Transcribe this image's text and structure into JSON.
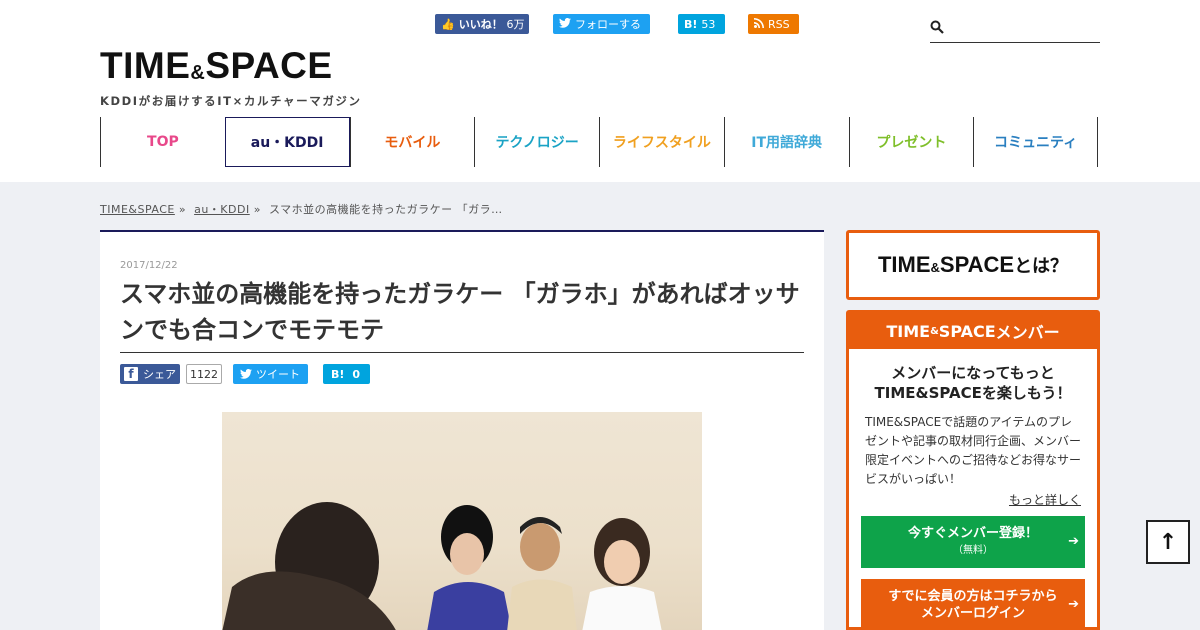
{
  "header": {
    "logo": {
      "main_left": "TIME",
      "amp": "&",
      "main_right": "SPACE",
      "tagline": "KDDIがお届けするIT×カルチャーマガジン"
    },
    "social": {
      "facebook": {
        "label": "いいね！",
        "count": "6万"
      },
      "twitter": {
        "label": "フォローする"
      },
      "hatena": {
        "label": "B!",
        "count": "53"
      },
      "rss": {
        "label": "RSS"
      }
    },
    "search": {
      "value": "",
      "placeholder": ""
    }
  },
  "nav": {
    "items": [
      {
        "label": "TOP",
        "color": "#e8488a"
      },
      {
        "label": "au・KDDI",
        "color": "#1a1a5a"
      },
      {
        "label": "モバイル",
        "color": "#e85d0e"
      },
      {
        "label": "テクノロジー",
        "color": "#1aa3c5"
      },
      {
        "label": "ライフスタイル",
        "color": "#f0a020"
      },
      {
        "label": "IT用語辞典",
        "color": "#3fa9d8"
      },
      {
        "label": "プレゼント",
        "color": "#7fbf2a"
      },
      {
        "label": "コミュニティ",
        "color": "#2a7fc0"
      }
    ],
    "active_index": 1
  },
  "breadcrumb": {
    "items": [
      "TIME&SPACE",
      "au・KDDI",
      "スマホ並の高機能を持ったガラケー 「ガラ…"
    ],
    "separator": "»"
  },
  "article": {
    "date": "2017/12/22",
    "title": "スマホ並の高機能を持ったガラケー 「ガラホ」があればオッサンでも合コンでモテモテ",
    "share": {
      "facebook_label": "シェア",
      "facebook_count": "1122",
      "twitter_label": "ツイート",
      "hatena_label": "B!",
      "hatena_count": "0"
    }
  },
  "sidebar": {
    "about": {
      "main_left": "TIME",
      "amp": "&",
      "main_right": "SPACE",
      "suffix": "とは？"
    },
    "member": {
      "header_left": "TIME",
      "header_amp": "&",
      "header_right": "SPACE",
      "header_suffix": " メンバー",
      "lead_line1": "メンバーになってもっと",
      "lead_line2": "TIME&SPACEを楽しもう！",
      "body": "TIME&SPACEで話題のアイテムのプレゼントや記事の取材同行企画、メンバー限定イベントへのご招待などお得なサービスがいっぱい！",
      "more_link": "もっと詳しく",
      "register_button": {
        "label": "今すぐメンバー登録！",
        "sub": "（無料）"
      },
      "login_button": {
        "line1": "すでに会員の方はコチラから",
        "line2": "メンバーログイン"
      }
    }
  },
  "colors": {
    "accent": "#e85d0e",
    "navy": "#1a1a5a",
    "green": "#0ea34a"
  },
  "to_top": {
    "icon": "arrow-up-icon"
  }
}
